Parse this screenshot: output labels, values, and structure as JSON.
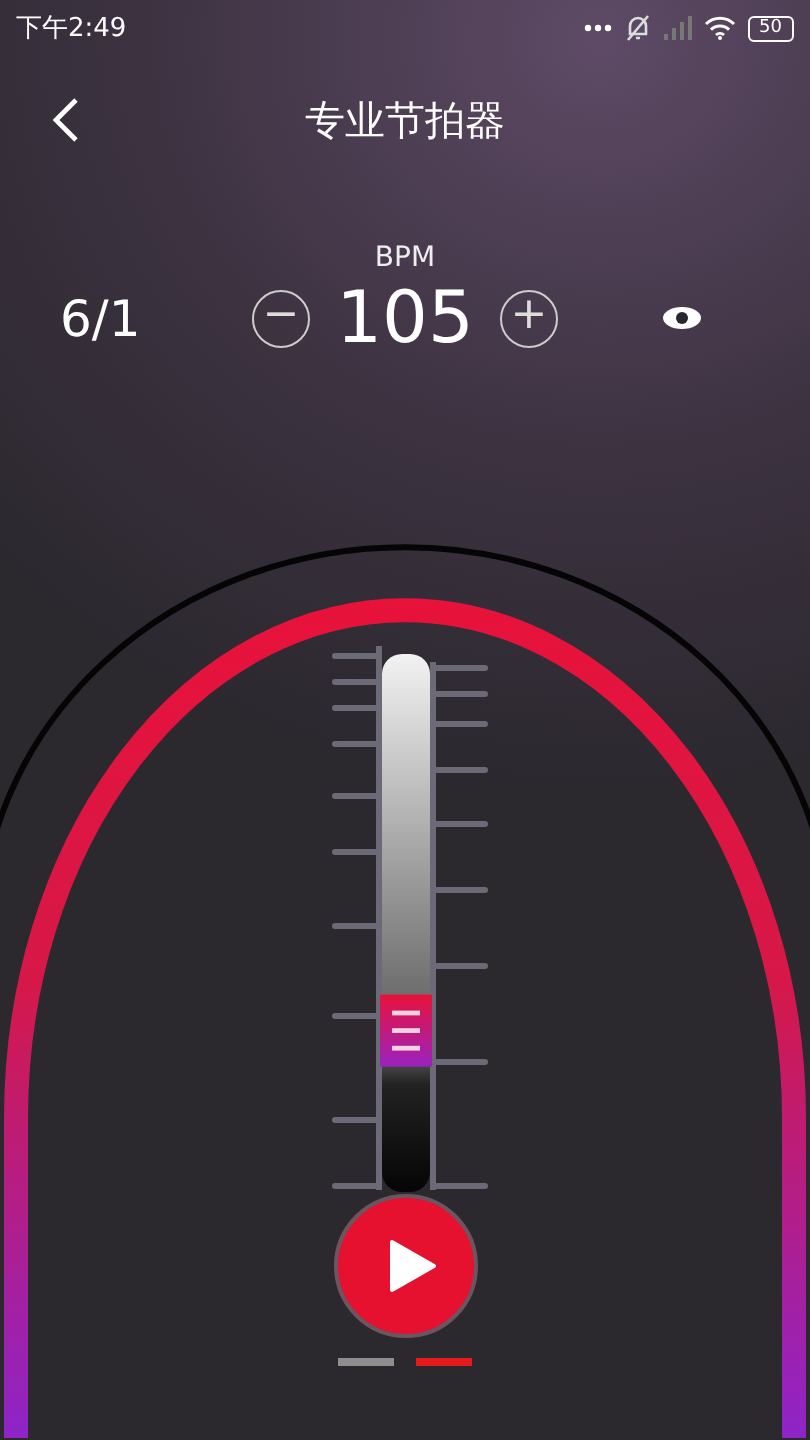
{
  "status_bar": {
    "time": "下午2:49",
    "battery": "50"
  },
  "header": {
    "title": "专业节拍器"
  },
  "tempo": {
    "unit": "BPM",
    "signature": "6/1",
    "bpm": "105",
    "minus": "−",
    "plus": "+"
  },
  "slider": {
    "level": 0.3
  },
  "pages": [
    {
      "selected": false
    },
    {
      "selected": true
    }
  ]
}
